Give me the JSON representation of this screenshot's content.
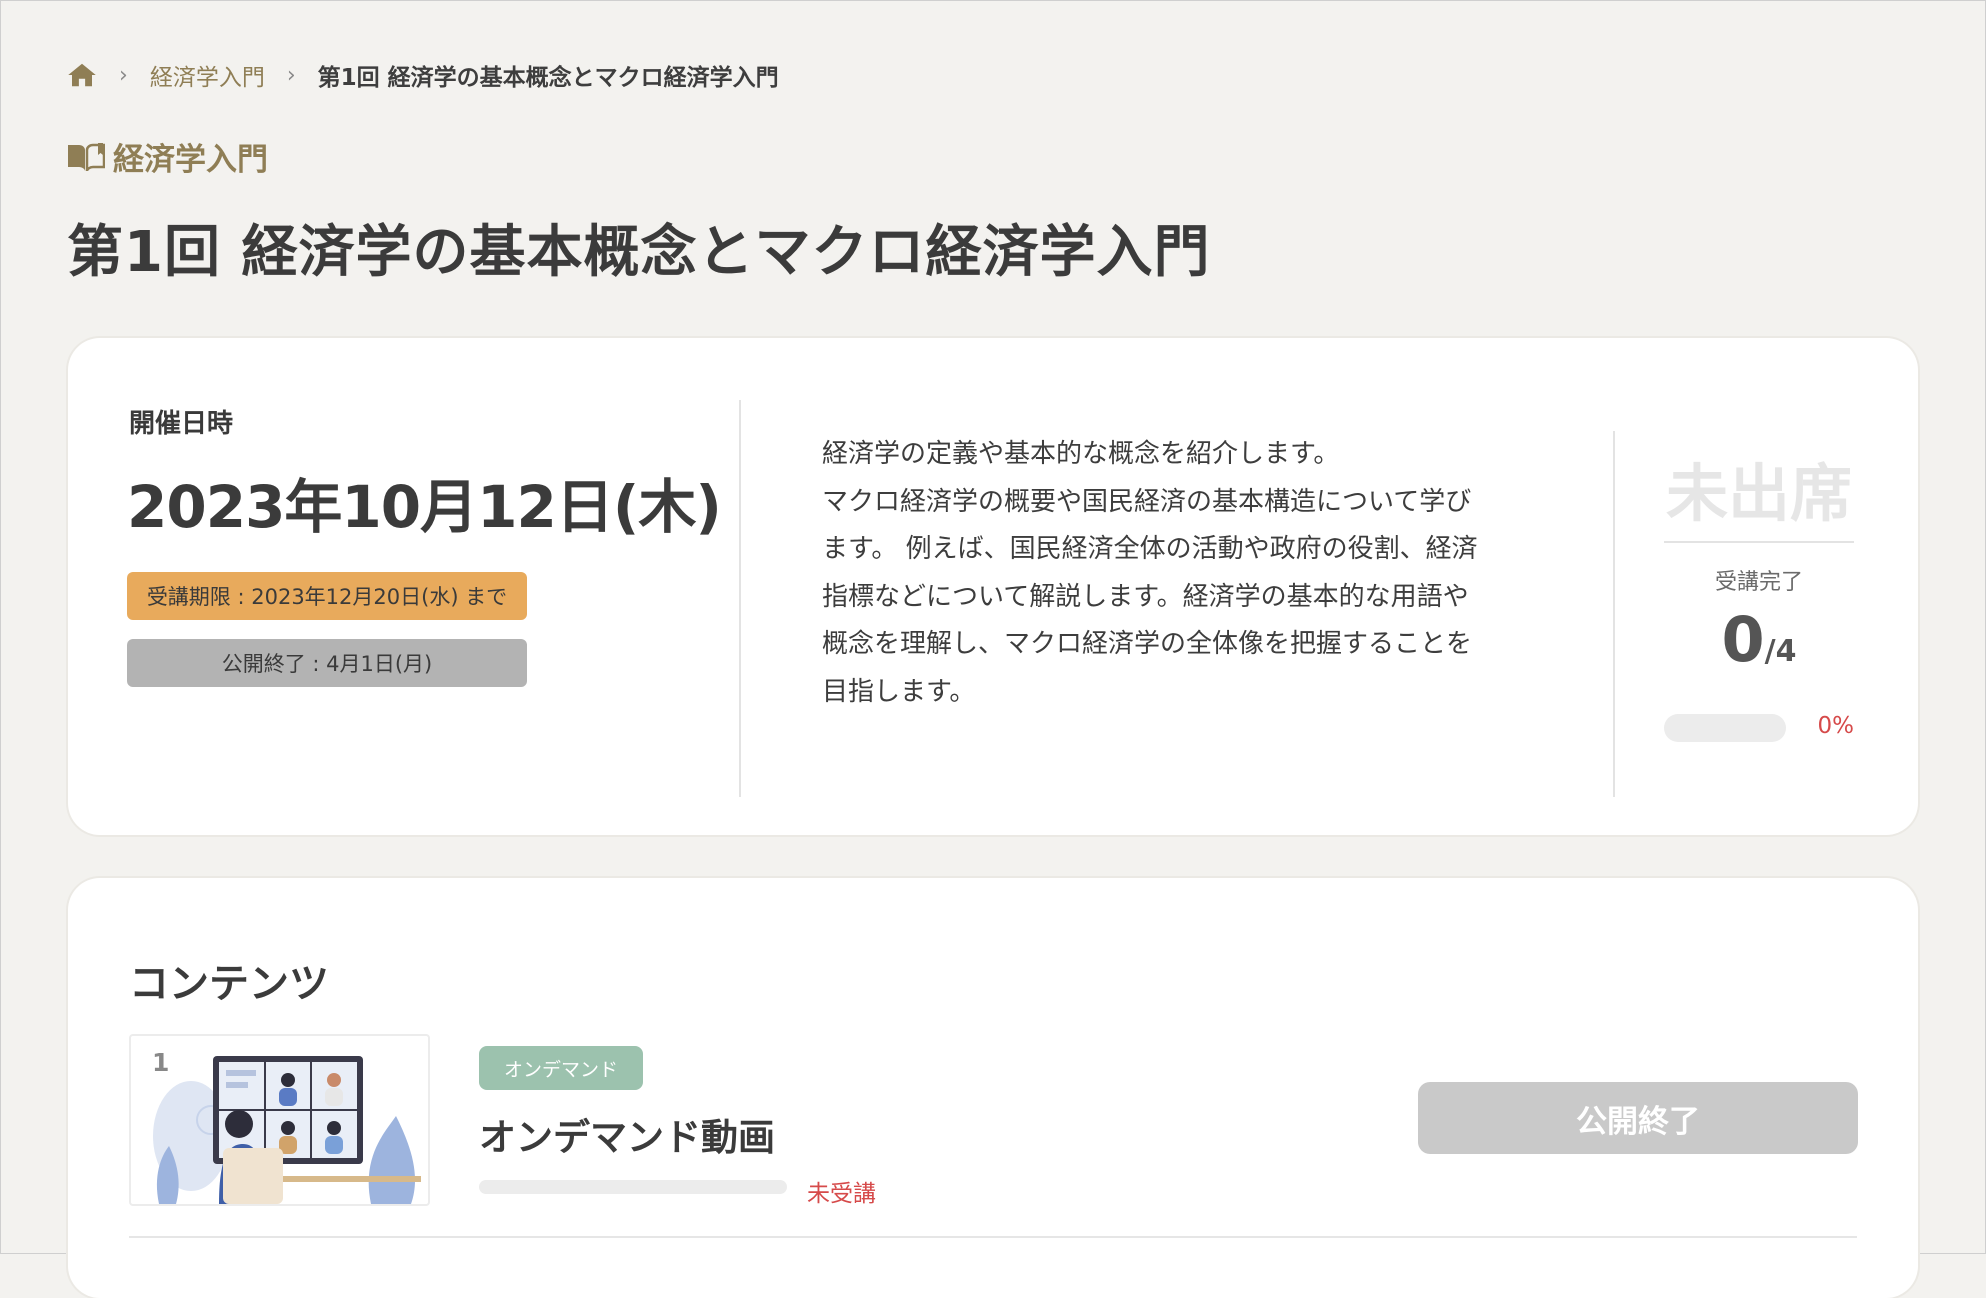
{
  "breadcrumb": {
    "home_icon": "home-icon",
    "separator": "›",
    "course": "経済学入門",
    "current": "第1回 経済学の基本概念とマクロ経済学入門"
  },
  "course_label": {
    "icon": "book-icon",
    "text": "経済学入門"
  },
  "page_title": "第1回 経済学の基本概念とマクロ経済学入門",
  "schedule": {
    "label": "開催日時",
    "date": "2023年10月12日(木)",
    "deadline": "受講期限 : 2023年12月20日(水) まで",
    "published_end": "公開終了 : 4月1日(月)"
  },
  "description": [
    "経済学の定義や基本的な概念を紹介します。",
    "マクロ経済学の概要や国民経済の基本構造について学び",
    "ます。 例えば、国民経済全体の活動や政府の役割、経済",
    "指標などについて解説します。経済学の基本的な用語や",
    "概念を理解し、マクロ経済学の全体像を把握することを",
    "目指します。"
  ],
  "attendance": {
    "status": "未出席",
    "complete_label": "受講完了",
    "completed": "0",
    "total": "/4",
    "progress": 0,
    "progress_label": "0%"
  },
  "contents": {
    "title": "コンテンツ",
    "items": [
      {
        "number": "1",
        "type": "オンデマンド",
        "title": "オンデマンド動画",
        "progress": 0,
        "status": "未受講",
        "button_label": "公開終了"
      }
    ]
  },
  "colors": {
    "accent_gold": "#8f7e55",
    "deadline_badge": "#e8aa5c",
    "closed_badge": "#b3b3b3",
    "type_badge": "#9cc2ae",
    "alert_red": "#d64a4a",
    "background": "#f3f2ef"
  }
}
